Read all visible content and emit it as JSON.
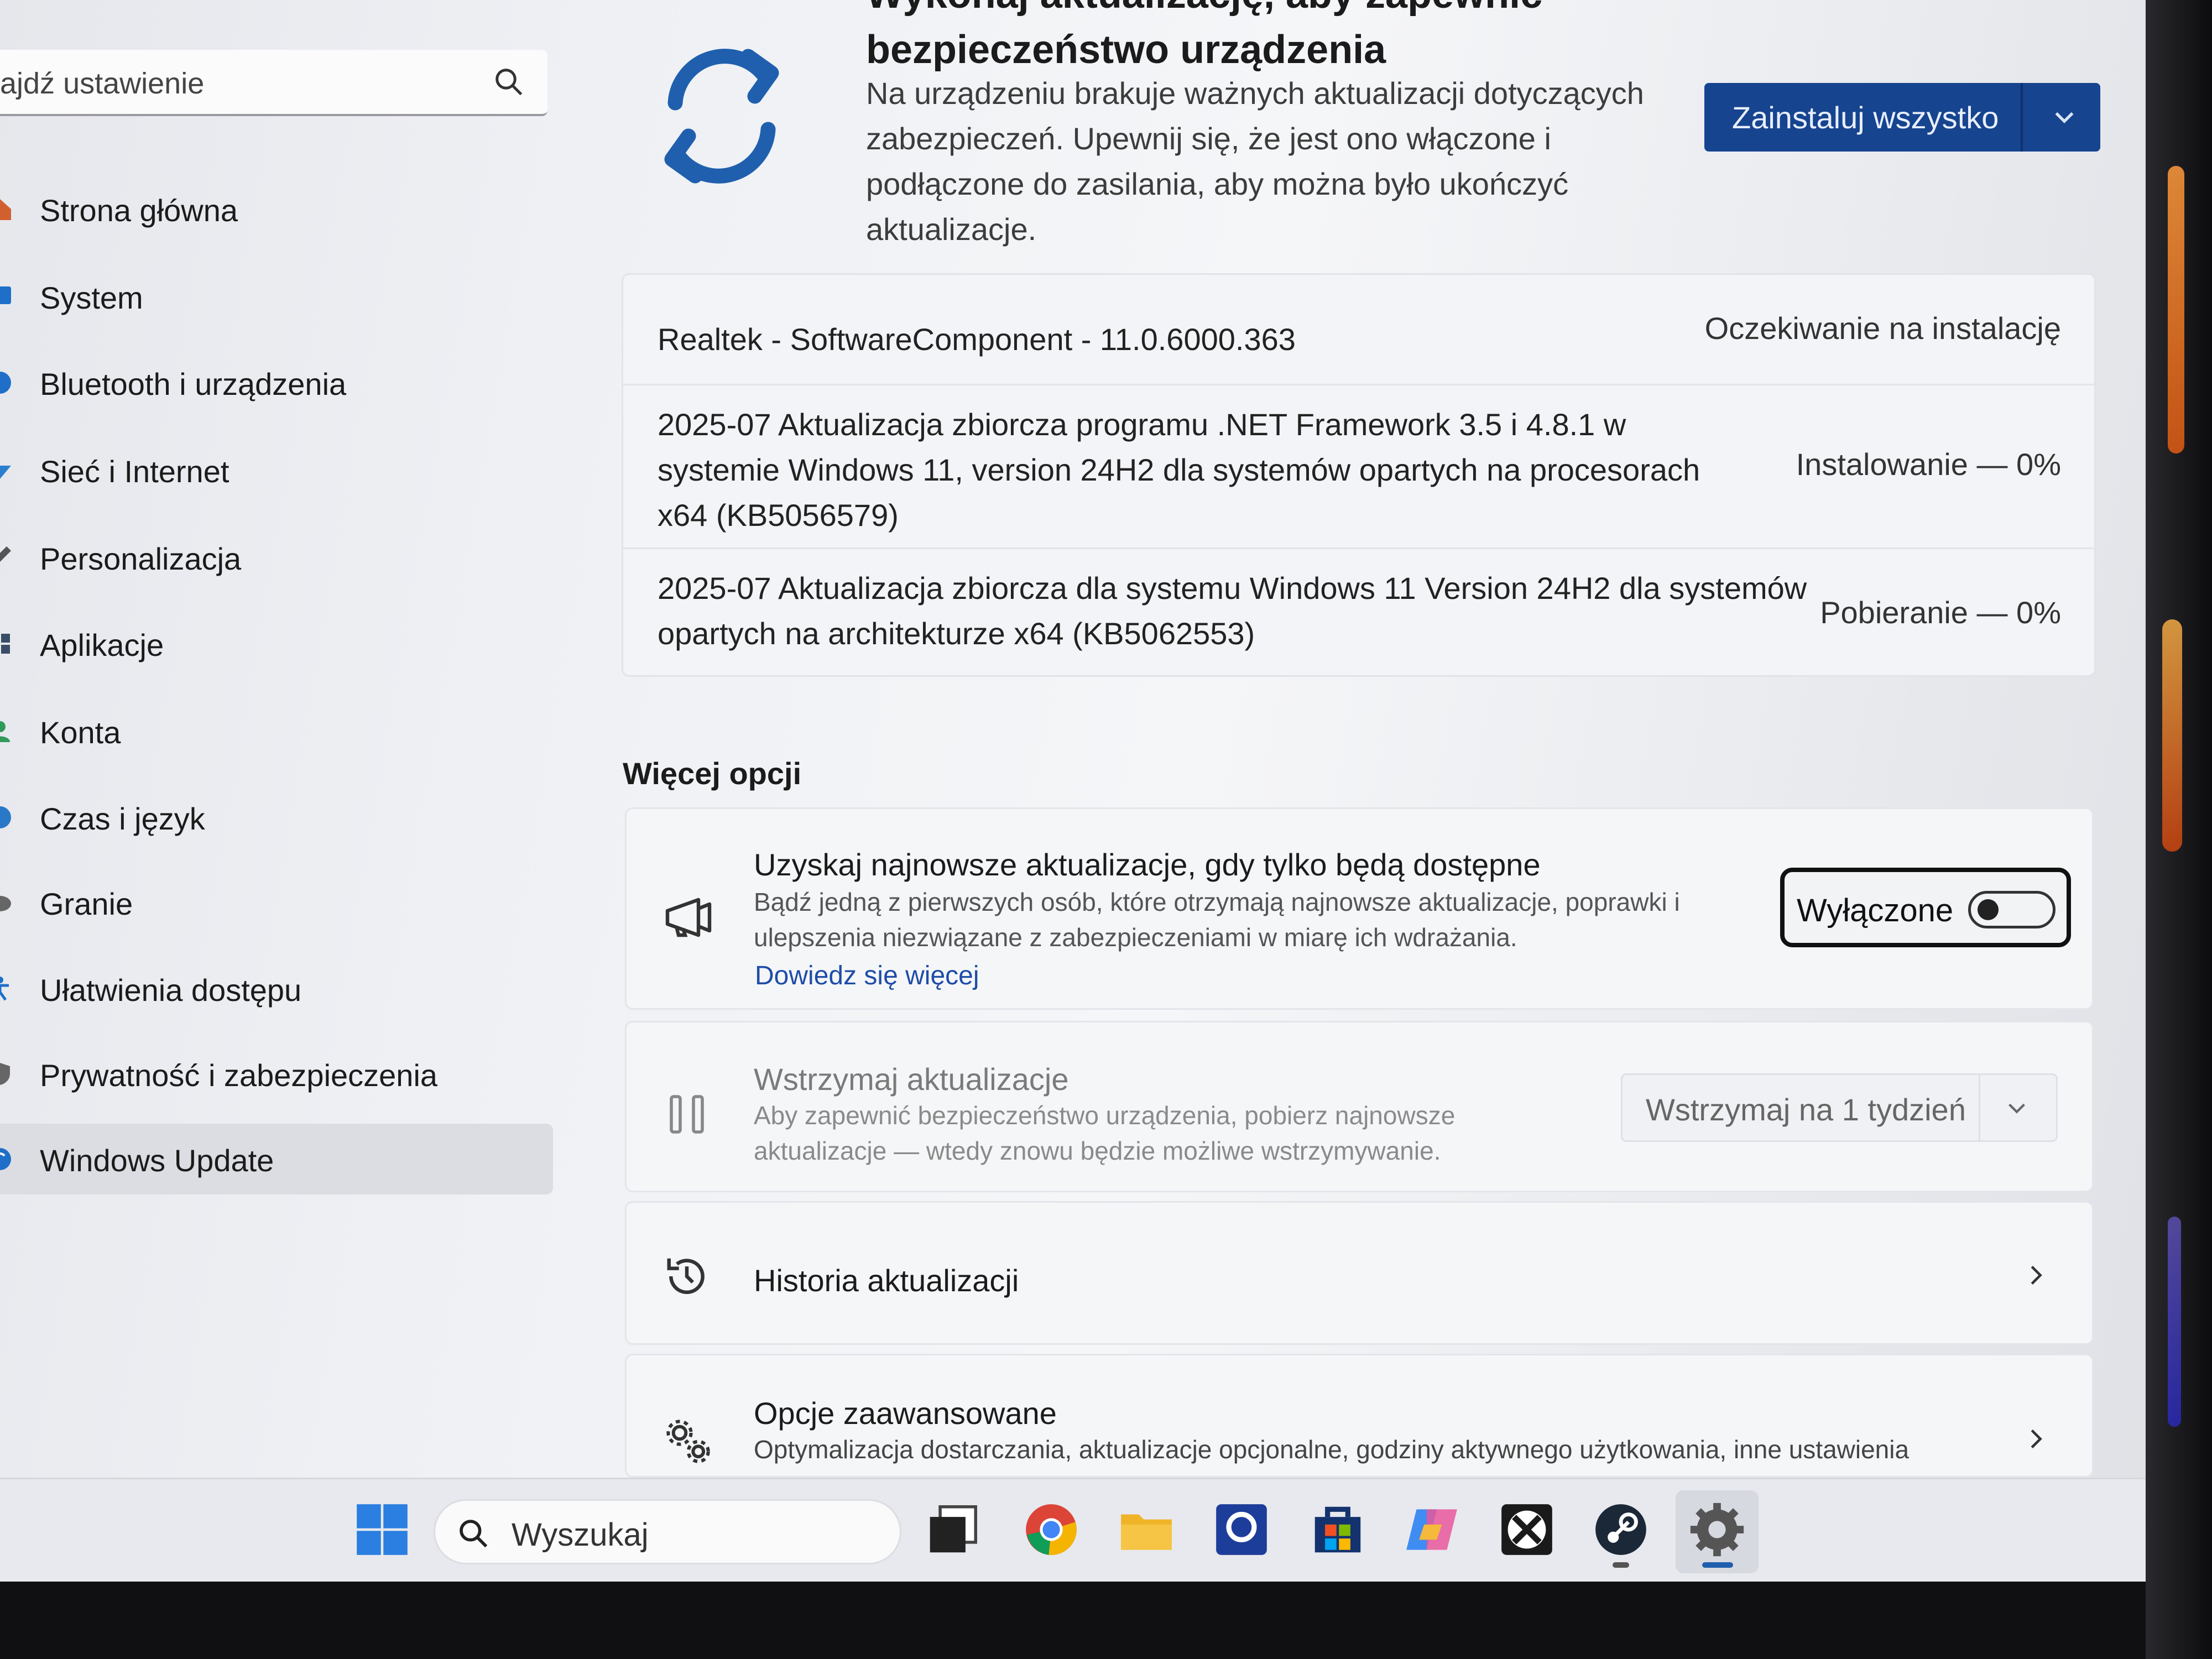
{
  "sidebar": {
    "search_placeholder": "ajdź ustawienie",
    "items": [
      {
        "label": "Strona główna",
        "icon": "home-icon"
      },
      {
        "label": "System",
        "icon": "system-icon"
      },
      {
        "label": "Bluetooth i urządzenia",
        "icon": "bluetooth-icon"
      },
      {
        "label": "Sieć i Internet",
        "icon": "network-icon"
      },
      {
        "label": "Personalizacja",
        "icon": "personalization-icon"
      },
      {
        "label": "Aplikacje",
        "icon": "apps-icon"
      },
      {
        "label": "Konta",
        "icon": "accounts-icon"
      },
      {
        "label": "Czas i język",
        "icon": "time-language-icon"
      },
      {
        "label": "Granie",
        "icon": "gaming-icon"
      },
      {
        "label": "Ułatwienia dostępu",
        "icon": "accessibility-icon"
      },
      {
        "label": "Prywatność i zabezpieczenia",
        "icon": "privacy-shield-icon"
      },
      {
        "label": "Windows Update",
        "icon": "windows-update-icon",
        "active": true
      }
    ]
  },
  "hero": {
    "title_line1": "Wykonaj aktualizację, aby zapewnić",
    "title_line2": "bezpieczeństwo urządzenia",
    "description": "Na urządzeniu brakuje ważnych aktualizacji dotyczących zabezpieczeń. Upewnij się, że jest ono włączone i podłączone do zasilania, aby można było ukończyć aktualizacje.",
    "install_button": "Zainstaluj wszystko"
  },
  "updates": [
    {
      "name": "Realtek - SoftwareComponent - 11.0.6000.363",
      "status": "Oczekiwanie na instalację"
    },
    {
      "name": "2025-07 Aktualizacja zbiorcza programu .NET Framework 3.5 i 4.8.1 w systemie Windows 11, version 24H2 dla systemów opartych na procesorach x64 (KB5056579)",
      "status": "Instalowanie — 0%"
    },
    {
      "name": "2025-07 Aktualizacja zbiorcza dla systemu Windows 11 Version 24H2 dla systemów opartych na architekturze x64 (KB5062553)",
      "status": "Pobieranie — 0%"
    }
  ],
  "more_options": {
    "heading": "Więcej opcji",
    "latest": {
      "title": "Uzyskaj najnowsze aktualizacje, gdy tylko będą dostępne",
      "description": "Bądź jedną z pierwszych osób, które otrzymają najnowsze aktualizacje, poprawki i ulepszenia niezwiązane z zabezpieczeniami w miarę ich wdrażania.",
      "link": "Dowiedz się więcej",
      "toggle_label": "Wyłączone"
    },
    "pause": {
      "title": "Wstrzymaj aktualizacje",
      "description": "Aby zapewnić bezpieczeństwo urządzenia, pobierz najnowsze aktualizacje — wtedy znowu będzie możliwe wstrzymywanie.",
      "dropdown": "Wstrzymaj na 1 tydzień"
    },
    "history": {
      "title": "Historia aktualizacji"
    },
    "advanced": {
      "title": "Opcje zaawansowane",
      "description": "Optymalizacja dostarczania, aktualizacje opcjonalne, godziny aktywnego użytkowania, inne ustawienia"
    }
  },
  "taskbar": {
    "search_label": "Wyszukaj",
    "apps": [
      "start-icon",
      "task-view-icon",
      "chrome-icon",
      "file-explorer-icon",
      "app-icon",
      "microsoft-store-icon",
      "copilot-icon",
      "xbox-icon",
      "steam-icon",
      "settings-icon"
    ]
  },
  "colors": {
    "accent": "#16448f",
    "link": "#1e4da8",
    "sync_icon": "#1f5fae"
  }
}
